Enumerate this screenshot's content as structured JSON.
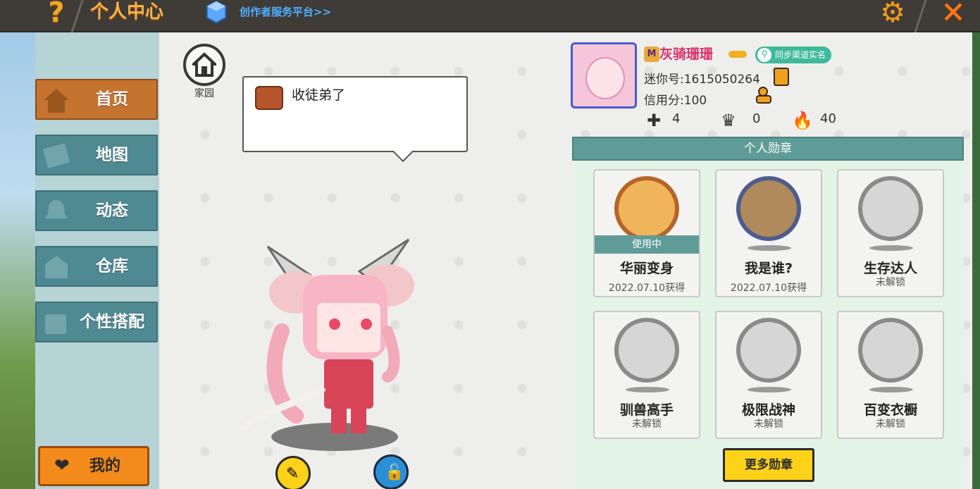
{
  "topbar": {
    "title": "个人中心",
    "creator_link": "创作者服务平台>>",
    "help_glyph": "?",
    "close_glyph": "✕",
    "gear_glyph": "⚙"
  },
  "sidebar": {
    "items": [
      {
        "label": "首页",
        "icon": "home-icon",
        "active": true
      },
      {
        "label": "地图",
        "icon": "map-icon",
        "active": false
      },
      {
        "label": "动态",
        "icon": "bell-icon",
        "active": false
      },
      {
        "label": "仓库",
        "icon": "warehouse-icon",
        "active": false
      },
      {
        "label": "个性搭配",
        "icon": "outfit-icon",
        "active": false
      }
    ],
    "mine_label": "我的"
  },
  "main": {
    "home_label": "家园",
    "bubble_text": "收徒弟了"
  },
  "profile": {
    "nickname": "灰骑珊珊",
    "sync_badge": "同步渠道实名",
    "mini_id": "迷你号:1615050264",
    "credit": "信用分:100",
    "stats": [
      {
        "icon": "plus-icon",
        "value": "4"
      },
      {
        "icon": "fans-icon",
        "value": "0"
      },
      {
        "icon": "fire-icon",
        "value": "40"
      }
    ]
  },
  "medals": {
    "header": "个人勋章",
    "items": [
      {
        "name": "华丽变身",
        "sub": "2022.07.10获得",
        "in_use": "使用中",
        "state": "gold"
      },
      {
        "name": "我是谁?",
        "sub": "2022.07.10获得",
        "in_use": "",
        "state": "silver"
      },
      {
        "name": "生存达人",
        "sub": "未解锁",
        "in_use": "",
        "state": "locked"
      },
      {
        "name": "驯兽高手",
        "sub": "未解锁",
        "in_use": "",
        "state": "locked"
      },
      {
        "name": "极限战神",
        "sub": "未解锁",
        "in_use": "",
        "state": "locked"
      },
      {
        "name": "百变衣橱",
        "sub": "未解锁",
        "in_use": "",
        "state": "locked"
      }
    ],
    "more_button": "更多勋章"
  },
  "colors": {
    "accent_orange": "#c5742f",
    "sidebar_teal": "#4f8a93",
    "nickname_pink": "#d82d6a",
    "button_yellow": "#ffd21a"
  }
}
